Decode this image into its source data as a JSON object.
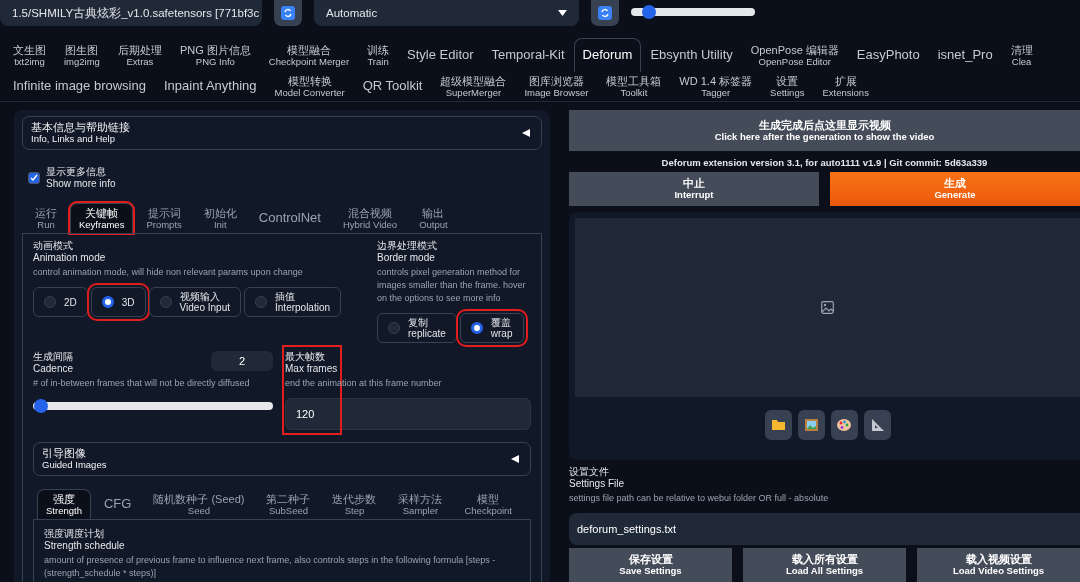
{
  "top_bar": {
    "checkpoint": {
      "value": "1.5/SHMILY古典炫彩_v1.0.safetensors [771bf3c"
    },
    "vae": {
      "value": "Automatic"
    },
    "clip_skip": {
      "level": 0.12
    }
  },
  "main_tabs": {
    "row_1": [
      {
        "label": "文生图",
        "sublabel": "txt2img",
        "selected": false
      },
      {
        "label": "图生图",
        "sublabel": "img2img",
        "selected": false
      },
      {
        "label": "后期处理",
        "sublabel": "Extras",
        "selected": false
      },
      {
        "label": "PNG 图片信息",
        "sublabel": "PNG Info",
        "selected": false
      },
      {
        "label": "模型融合",
        "sublabel": "Checkpoint Merger",
        "selected": false
      },
      {
        "label": "训练",
        "sublabel": "Train",
        "selected": false
      },
      {
        "label": "Style Editor",
        "selected": false
      },
      {
        "label": "Temporal-Kit",
        "selected": false
      },
      {
        "label": "Deforum",
        "selected": true
      },
      {
        "label": "Ebsynth Utility",
        "selected": false
      },
      {
        "label": "OpenPose 编辑器",
        "sublabel": "OpenPose Editor",
        "selected": false
      },
      {
        "label": "EasyPhoto",
        "selected": false
      },
      {
        "label": "isnet_Pro",
        "selected": false
      },
      {
        "label": "清理",
        "sublabel": "Clea",
        "selected": false
      }
    ],
    "row_2": [
      {
        "label": "Infinite image browsing",
        "selected": false
      },
      {
        "label": "Inpaint Anything",
        "selected": false
      },
      {
        "label": "模型转换",
        "sublabel": "Model Converter",
        "selected": false
      },
      {
        "label": "QR Toolkit",
        "selected": false
      },
      {
        "label": "超级模型融合",
        "sublabel": "SuperMerger",
        "selected": false
      },
      {
        "label": "图库浏览器",
        "sublabel": "Image Browser",
        "selected": false
      },
      {
        "label": "模型工具箱",
        "sublabel": "Toolkit",
        "selected": false
      },
      {
        "label": "WD 1.4 标签器",
        "sublabel": "Tagger",
        "selected": false
      },
      {
        "label": "设置",
        "sublabel": "Settings",
        "selected": false
      },
      {
        "label": "扩展",
        "sublabel": "Extensions",
        "selected": false
      }
    ]
  },
  "deforum": {
    "info_accordion": {
      "title": "基本信息与帮助链接",
      "subtitle": "Info, Links and Help",
      "expanded": false
    },
    "show_more_info": {
      "label": "显示更多信息",
      "sublabel": "Show more info",
      "checked": true
    },
    "tabs": [
      {
        "label": "运行",
        "sublabel": "Run",
        "selected": false,
        "highlighted": false
      },
      {
        "label": "关键帧",
        "sublabel": "Keyframes",
        "selected": true,
        "highlighted": true
      },
      {
        "label": "提示词",
        "sublabel": "Prompts",
        "selected": false,
        "highlighted": false
      },
      {
        "label": "初始化",
        "sublabel": "Init",
        "selected": false,
        "highlighted": false
      },
      {
        "label": "ControlNet",
        "selected": false,
        "highlighted": false
      },
      {
        "label": "混合视频",
        "sublabel": "Hybrid Video",
        "selected": false,
        "highlighted": false
      },
      {
        "label": "输出",
        "sublabel": "Output",
        "selected": false,
        "highlighted": false
      }
    ],
    "animation_mode": {
      "label": "动画模式",
      "sublabel": "Animation mode",
      "description": "control animation mode, will hide non relevant params upon change",
      "options": [
        {
          "label": "2D",
          "selected": false,
          "highlighted": false
        },
        {
          "label": "3D",
          "selected": true,
          "highlighted": true
        },
        {
          "label": "视频输入",
          "sublabel": "Video Input",
          "selected": false,
          "highlighted": false
        },
        {
          "label": "插值",
          "sublabel": "Interpolation",
          "selected": false,
          "highlighted": false
        }
      ]
    },
    "border_mode": {
      "label": "边界处理模式",
      "sublabel": "Border mode",
      "description": "controls pixel generation method for images smaller than the frame. hover on the options to see more info",
      "options": [
        {
          "label": "复制",
          "sublabel": "replicate",
          "selected": false,
          "highlighted": false
        },
        {
          "label": "覆盖",
          "sublabel": "wrap",
          "selected": true,
          "highlighted": true
        }
      ]
    },
    "cadence": {
      "label": "生成间隔",
      "sublabel": "Cadence",
      "description": "# of in-between frames that will not be directly diffused",
      "value": "2",
      "level": 0.02
    },
    "max_frames": {
      "label": "最大帧数",
      "sublabel": "Max frames",
      "description": "end the animation at this frame number",
      "value": "120",
      "highlighted": true
    },
    "guided_images": {
      "title": "引导图像",
      "subtitle": "Guided Images",
      "expanded": false
    },
    "schedule_tabs": [
      {
        "label": "强度",
        "sublabel": "Strength",
        "selected": true
      },
      {
        "label": "CFG",
        "selected": false
      },
      {
        "label": "随机数种子 (Seed)",
        "sublabel": "Seed",
        "selected": false
      },
      {
        "label": "第二种子",
        "sublabel": "SubSeed",
        "selected": false
      },
      {
        "label": "迭代步数",
        "sublabel": "Step",
        "selected": false
      },
      {
        "label": "采样方法",
        "sublabel": "Sampler",
        "selected": false
      },
      {
        "label": "模型",
        "sublabel": "Checkpoint",
        "selected": false
      }
    ],
    "strength_schedule": {
      "label": "强度调度计划",
      "sublabel": "Strength schedule",
      "description": "amount of presence of previous frame to influence next frame, also controls steps in the following formula [steps - (strength_schedule * steps)]"
    }
  },
  "output": {
    "show_video_button": {
      "label": "生成完成后点这里显示视频",
      "sublabel": "Click here after the generation to show the video"
    },
    "version_text": "Deforum extension version 3.1, for auto1111 v1.9 | Git commit: 5d63a339",
    "interrupt_button": {
      "label": "中止",
      "sublabel": "Interrupt"
    },
    "generate_button": {
      "label": "生成",
      "sublabel": "Generate"
    },
    "tool_buttons": [
      {
        "kind": "folder"
      },
      {
        "kind": "picture"
      },
      {
        "kind": "palette"
      },
      {
        "kind": "ruler"
      }
    ],
    "settings_file": {
      "label": "设置文件",
      "sublabel": "Settings File",
      "description": "settings file path can be relative to webui folder OR full - absolute",
      "value": "deforum_settings.txt"
    },
    "settings_buttons": [
      {
        "label": "保存设置",
        "sublabel": "Save Settings"
      },
      {
        "label": "载入所有设置",
        "sublabel": "Load All Settings"
      },
      {
        "label": "载入视频设置",
        "sublabel": "Load Video Settings"
      }
    ]
  }
}
